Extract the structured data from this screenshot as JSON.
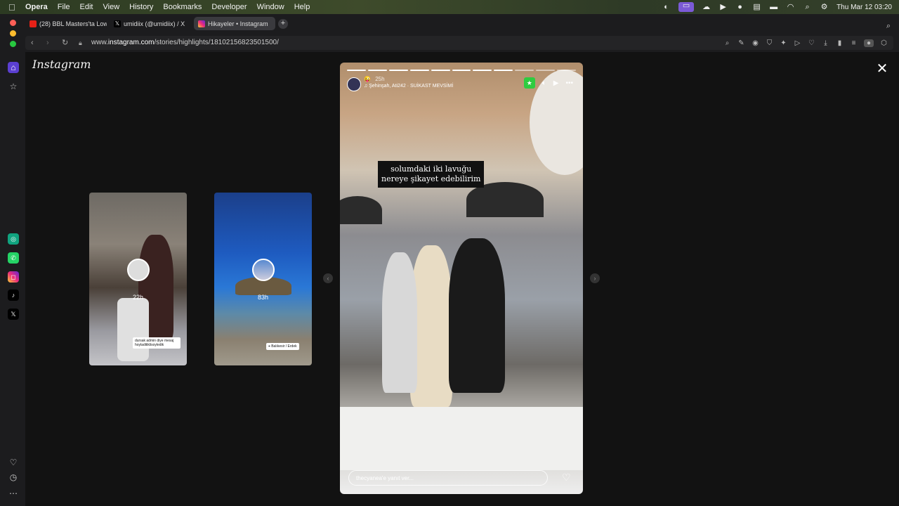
{
  "menubar": {
    "items": [
      "Opera",
      "File",
      "Edit",
      "View",
      "History",
      "Bookmarks",
      "Developer",
      "Window",
      "Help"
    ],
    "datetime": "Thu Mar 12  03:20"
  },
  "tabs": [
    {
      "label": "(28) BBL Masters'ta Low",
      "icon": "youtube-icon",
      "color": "#e62117"
    },
    {
      "label": "umidiix (@umidiix) / X",
      "icon": "x-icon",
      "color": "#000000"
    },
    {
      "label": "Hikayeler • Instagram",
      "icon": "instagram-icon",
      "color": "#d6249f"
    }
  ],
  "address": {
    "prefix": "www.",
    "domain": "instagram.com",
    "path": "/stories/highlights/18102156823501500/"
  },
  "page": {
    "brand": "Instagram",
    "close": "✕"
  },
  "thumbnails": [
    {
      "time": "22h",
      "sticker": "dursak admin diye mesaj hoyladitiklisoyledik"
    },
    {
      "time": "83h",
      "sticker": "⌖ Balıkesir / Erdek"
    }
  ],
  "story": {
    "time": "25h",
    "music": "Şehinşah, Ati242 · SUİKAST MEVSİMİ",
    "caption_line1": "solumdaki iki lavuğu",
    "caption_line2": "nereye şikayet edebilirim",
    "reply_placeholder": "thecyanea'e yanıt ver...",
    "progress_total": 11,
    "progress_done": 8
  }
}
